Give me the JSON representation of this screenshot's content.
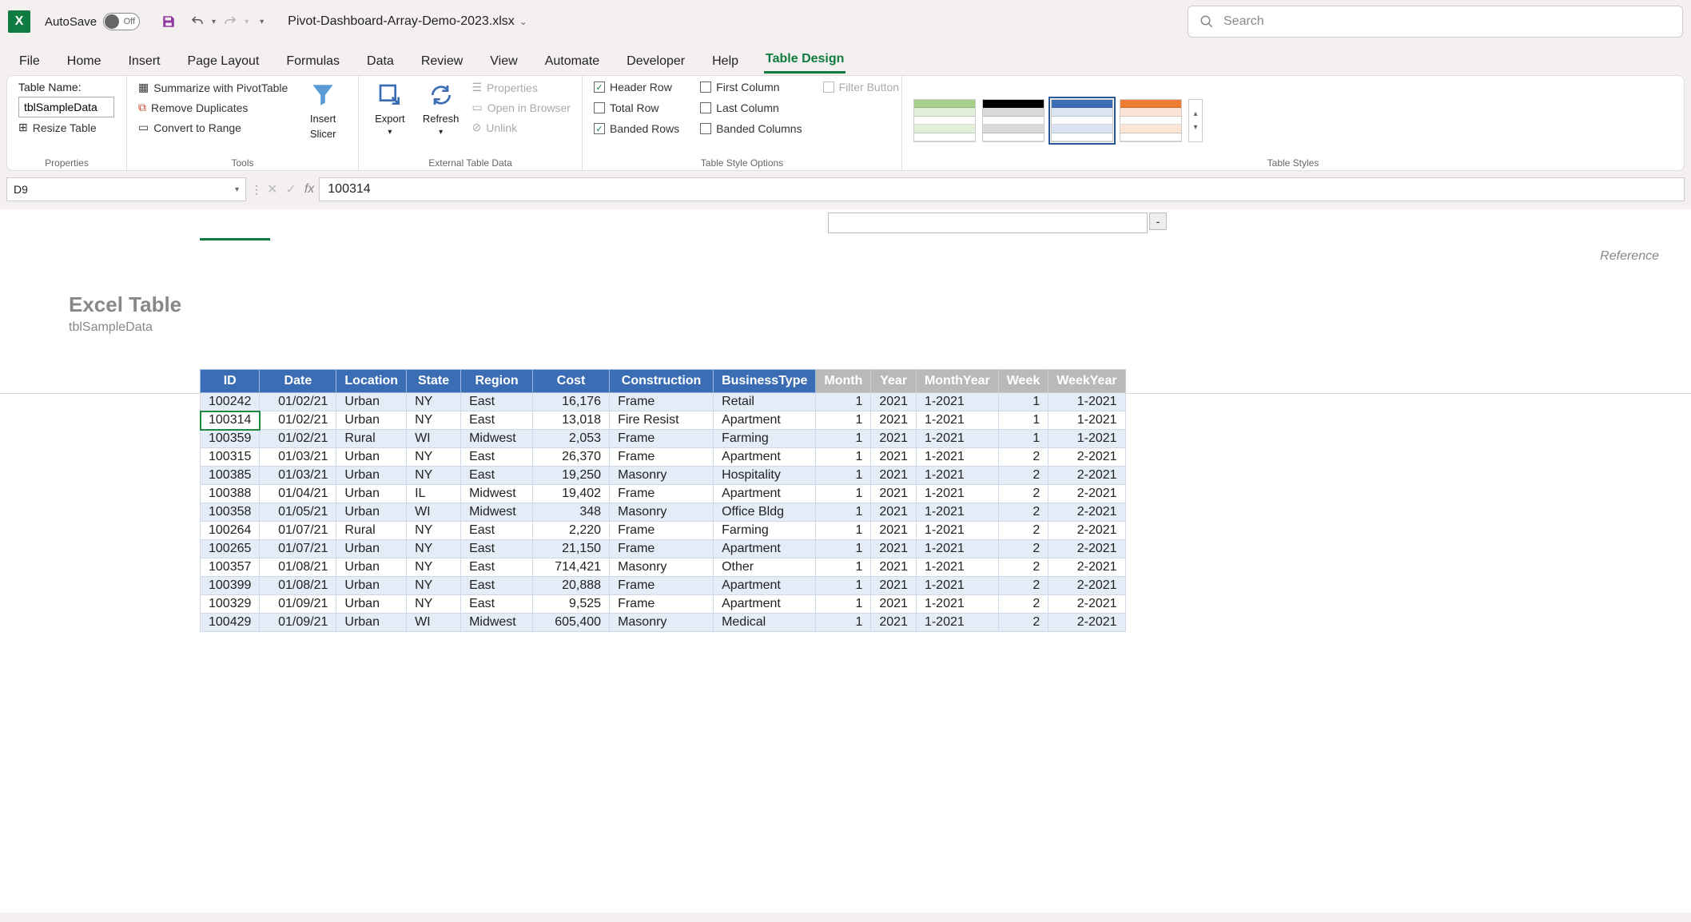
{
  "titlebar": {
    "autosave_label": "AutoSave",
    "autosave_state": "Off",
    "filename": "Pivot-Dashboard-Array-Demo-2023.xlsx",
    "search_placeholder": "Search"
  },
  "tabs": [
    "File",
    "Home",
    "Insert",
    "Page Layout",
    "Formulas",
    "Data",
    "Review",
    "View",
    "Automate",
    "Developer",
    "Help",
    "Table Design"
  ],
  "active_tab": "Table Design",
  "ribbon": {
    "properties": {
      "label": "Properties",
      "table_name_label": "Table Name:",
      "table_name_value": "tblSampleData",
      "resize": "Resize Table"
    },
    "tools": {
      "label": "Tools",
      "summarize": "Summarize with PivotTable",
      "remove_dup": "Remove Duplicates",
      "convert": "Convert to Range",
      "insert_slicer": "Insert Slicer",
      "insert_slicer_l1": "Insert",
      "insert_slicer_l2": "Slicer"
    },
    "external": {
      "label": "External Table Data",
      "export": "Export",
      "refresh": "Refresh",
      "properties": "Properties",
      "open_browser": "Open in Browser",
      "unlink": "Unlink"
    },
    "styleopts": {
      "label": "Table Style Options",
      "header_row": "Header Row",
      "total_row": "Total Row",
      "banded_rows": "Banded Rows",
      "first_col": "First Column",
      "last_col": "Last Column",
      "banded_cols": "Banded Columns",
      "filter_btn": "Filter Button"
    },
    "styles": {
      "label": "Table Styles"
    }
  },
  "formula_bar": {
    "name_box": "D9",
    "formula": "100314"
  },
  "sheet": {
    "reference_label": "Reference",
    "title": "Excel Table",
    "subtitle": "tblSampleData"
  },
  "table": {
    "headers_main": [
      "ID",
      "Date",
      "Location",
      "State",
      "Region",
      "Cost",
      "Construction",
      "BusinessType"
    ],
    "headers_grey": [
      "Month",
      "Year",
      "MonthYear",
      "Week",
      "WeekYear"
    ],
    "selected_id": "100314",
    "rows": [
      {
        "id": "100242",
        "date": "01/02/21",
        "loc": "Urban",
        "state": "NY",
        "region": "East",
        "cost": "16,176",
        "cons": "Frame",
        "btype": "Retail",
        "month": "1",
        "year": "2021",
        "my": "1-2021",
        "week": "1",
        "wy": "1-2021"
      },
      {
        "id": "100314",
        "date": "01/02/21",
        "loc": "Urban",
        "state": "NY",
        "region": "East",
        "cost": "13,018",
        "cons": "Fire Resist",
        "btype": "Apartment",
        "month": "1",
        "year": "2021",
        "my": "1-2021",
        "week": "1",
        "wy": "1-2021"
      },
      {
        "id": "100359",
        "date": "01/02/21",
        "loc": "Rural",
        "state": "WI",
        "region": "Midwest",
        "cost": "2,053",
        "cons": "Frame",
        "btype": "Farming",
        "month": "1",
        "year": "2021",
        "my": "1-2021",
        "week": "1",
        "wy": "1-2021"
      },
      {
        "id": "100315",
        "date": "01/03/21",
        "loc": "Urban",
        "state": "NY",
        "region": "East",
        "cost": "26,370",
        "cons": "Frame",
        "btype": "Apartment",
        "month": "1",
        "year": "2021",
        "my": "1-2021",
        "week": "2",
        "wy": "2-2021"
      },
      {
        "id": "100385",
        "date": "01/03/21",
        "loc": "Urban",
        "state": "NY",
        "region": "East",
        "cost": "19,250",
        "cons": "Masonry",
        "btype": "Hospitality",
        "month": "1",
        "year": "2021",
        "my": "1-2021",
        "week": "2",
        "wy": "2-2021"
      },
      {
        "id": "100388",
        "date": "01/04/21",
        "loc": "Urban",
        "state": "IL",
        "region": "Midwest",
        "cost": "19,402",
        "cons": "Frame",
        "btype": "Apartment",
        "month": "1",
        "year": "2021",
        "my": "1-2021",
        "week": "2",
        "wy": "2-2021"
      },
      {
        "id": "100358",
        "date": "01/05/21",
        "loc": "Urban",
        "state": "WI",
        "region": "Midwest",
        "cost": "348",
        "cons": "Masonry",
        "btype": "Office Bldg",
        "month": "1",
        "year": "2021",
        "my": "1-2021",
        "week": "2",
        "wy": "2-2021"
      },
      {
        "id": "100264",
        "date": "01/07/21",
        "loc": "Rural",
        "state": "NY",
        "region": "East",
        "cost": "2,220",
        "cons": "Frame",
        "btype": "Farming",
        "month": "1",
        "year": "2021",
        "my": "1-2021",
        "week": "2",
        "wy": "2-2021"
      },
      {
        "id": "100265",
        "date": "01/07/21",
        "loc": "Urban",
        "state": "NY",
        "region": "East",
        "cost": "21,150",
        "cons": "Frame",
        "btype": "Apartment",
        "month": "1",
        "year": "2021",
        "my": "1-2021",
        "week": "2",
        "wy": "2-2021"
      },
      {
        "id": "100357",
        "date": "01/08/21",
        "loc": "Urban",
        "state": "NY",
        "region": "East",
        "cost": "714,421",
        "cons": "Masonry",
        "btype": "Other",
        "month": "1",
        "year": "2021",
        "my": "1-2021",
        "week": "2",
        "wy": "2-2021"
      },
      {
        "id": "100399",
        "date": "01/08/21",
        "loc": "Urban",
        "state": "NY",
        "region": "East",
        "cost": "20,888",
        "cons": "Frame",
        "btype": "Apartment",
        "month": "1",
        "year": "2021",
        "my": "1-2021",
        "week": "2",
        "wy": "2-2021"
      },
      {
        "id": "100329",
        "date": "01/09/21",
        "loc": "Urban",
        "state": "NY",
        "region": "East",
        "cost": "9,525",
        "cons": "Frame",
        "btype": "Apartment",
        "month": "1",
        "year": "2021",
        "my": "1-2021",
        "week": "2",
        "wy": "2-2021"
      },
      {
        "id": "100429",
        "date": "01/09/21",
        "loc": "Urban",
        "state": "WI",
        "region": "Midwest",
        "cost": "605,400",
        "cons": "Masonry",
        "btype": "Medical",
        "month": "1",
        "year": "2021",
        "my": "1-2021",
        "week": "2",
        "wy": "2-2021"
      }
    ]
  }
}
